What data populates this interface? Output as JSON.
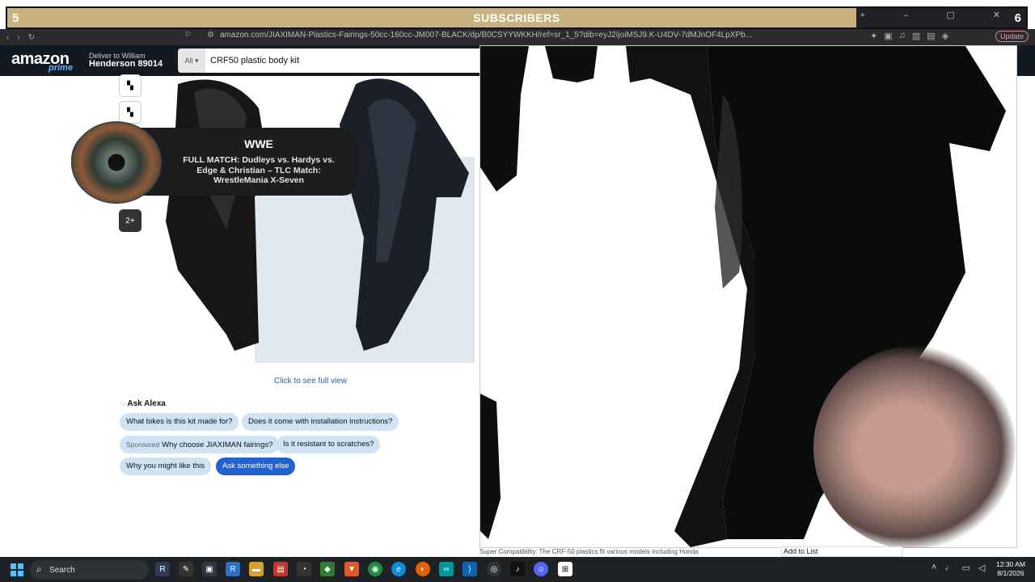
{
  "overlay": {
    "left_count": "5",
    "title": "SUBSCRIBERS",
    "right_count": "6",
    "window_controls": "+ – ▢ ✕"
  },
  "browser": {
    "url": "amazon.com/JIAXIMAN-Plastics-Fairings-50cc-160cc-JM007-BLACK/dp/B0CSYYWKKH/ref=sr_1_5?dib=eyJ2IjoiMSJ9.K-U4DV-7dMJnOF4LpXPb...",
    "update_label": "Update"
  },
  "amazon": {
    "logo": "amazon",
    "prime": "prime",
    "deliver_line1": "Deliver to William",
    "deliver_line2": "Henderson 89014",
    "search_category": "All",
    "search_value": "CRF50 plastic body kit",
    "thumb_more": "2+",
    "full_view": "Click to see full view",
    "alexa_heading": "Ask Alexa",
    "chips": [
      "What bikes is this kit made for?",
      "Does it come with installation instructions?",
      "Why choose JIAXIMAN fairings?",
      "Is it resistant to scratches?",
      "Why you might like this",
      "Ask something else"
    ],
    "sponsored_label": "Sponsored",
    "below_text": "Super Compatibility: The CRF-50 plastics fit various models including Honda",
    "add_to_list": "Add to List"
  },
  "wwe_popup": {
    "brand": "WWE",
    "title": "FULL MATCH: Dudleys vs. Hardys vs. Edge & Christian – TLC Match: WrestleMania X-Seven"
  },
  "taskbar": {
    "search_label": "Search",
    "time": "12:30 AM",
    "date": "8/1/2026"
  },
  "colors": {
    "overlay_bar": "#c8b27e",
    "amazon_header": "#131921",
    "chip_bg": "#cfe3f5",
    "chip_primary": "#2162d1",
    "taskbar": "#1f2224"
  }
}
